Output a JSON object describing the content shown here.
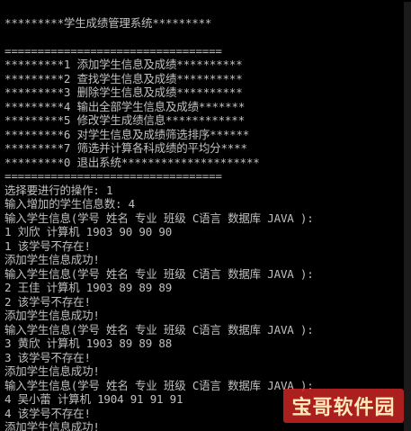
{
  "console": {
    "lines": [
      "",
      "*********学生成绩管理系统*********",
      "",
      "=================================",
      "*********1 添加学生信息及成绩**********",
      "*********2 查找学生信息及成绩**********",
      "*********3 删除学生信息及成绩**********",
      "*********4 输出全部学生信息及成绩*******",
      "*********5 修改学生成绩信息************",
      "*********6 对学生信息及成绩筛选排序******",
      "*********7 筛选并计算各科成绩的平均分****",
      "*********0 退出系统*********************",
      "=================================",
      "选择要进行的操作: 1",
      "输入增加的学生信息数: 4",
      "输入学生信息(学号 姓名 专业 班级 C语言 数据库 JAVA ):",
      "1 刘欣 计算机 1903 90 90 90",
      "1 该学号不存在!",
      "添加学生信息成功!",
      "输入学生信息(学号 姓名 专业 班级 C语言 数据库 JAVA ):",
      "2 王佳 计算机 1903 89 89 89",
      "2 该学号不存在!",
      "添加学生信息成功!",
      "输入学生信息(学号 姓名 专业 班级 C语言 数据库 JAVA ):",
      "3 黄欣 计算机 1903 89 89 88",
      "3 该学号不存在!",
      "添加学生信息成功!",
      "输入学生信息(学号 姓名 专业 班级 C语言 数据库 JAVA ):",
      "4 吴小蕾 计算机 1904 91 91 91",
      "4 该学号不存在!",
      "添加学生信息成功!"
    ]
  },
  "watermark": {
    "text": "宝哥软件园"
  },
  "colors": {
    "background": "#000000",
    "text": "#c0c0c0",
    "watermark_bg": "#dc2828"
  }
}
